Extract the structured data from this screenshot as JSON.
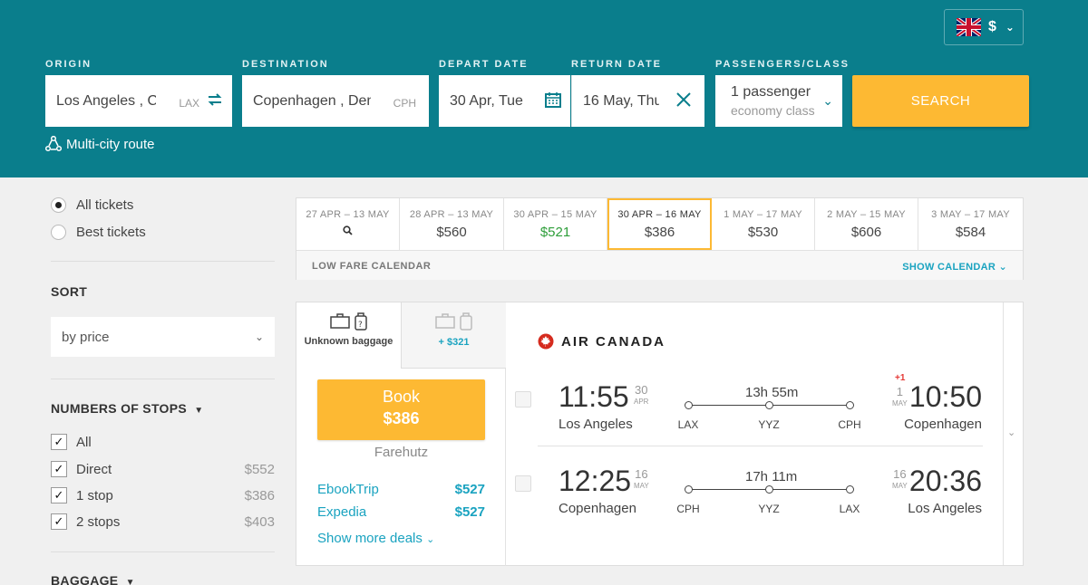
{
  "header": {
    "currency_symbol": "$",
    "labels": {
      "origin": "ORIGIN",
      "destination": "DESTINATION",
      "depart_date": "DEPART DATE",
      "return_date": "RETURN DATE",
      "passengers_class": "PASSENGERS/CLASS"
    },
    "origin_value": "Los Angeles , CA",
    "origin_code": "LAX",
    "destination_value": "Copenhagen , Denmark",
    "destination_code": "CPH",
    "depart_value": "30 Apr, Tue",
    "return_value": "16 May, Thu",
    "passengers": "1 passenger",
    "class": "economy class",
    "search_label": "SEARCH",
    "multicity_label": "Multi-city route"
  },
  "sidebar": {
    "ticket_options": [
      "All tickets",
      "Best tickets"
    ],
    "sort_heading": "SORT",
    "sort_value": "by price",
    "stops_heading": "NUMBERS OF STOPS",
    "stops": [
      {
        "label": "All",
        "price": ""
      },
      {
        "label": "Direct",
        "price": "$552"
      },
      {
        "label": "1 stop",
        "price": "$386"
      },
      {
        "label": "2 stops",
        "price": "$403"
      }
    ],
    "baggage_heading": "BAGGAGE"
  },
  "calendar": {
    "cells": [
      {
        "dates": "27 APR – 13 MAY",
        "price": ""
      },
      {
        "dates": "28 APR – 13 MAY",
        "price": "$560"
      },
      {
        "dates": "30 APR – 15 MAY",
        "price": "$521"
      },
      {
        "dates": "30 APR – 16 MAY",
        "price": "$386"
      },
      {
        "dates": "1 MAY – 17 MAY",
        "price": "$530"
      },
      {
        "dates": "2 MAY – 15 MAY",
        "price": "$606"
      },
      {
        "dates": "3 MAY – 17 MAY",
        "price": "$584"
      }
    ],
    "low_fare_label": "LOW FARE CALENDAR",
    "show_calendar_label": "SHOW CALENDAR",
    "colors": {
      "cheap": "#2e9e3a",
      "active_border": "#fdb933"
    }
  },
  "result": {
    "baggage_tab_label": "Unknown baggage",
    "baggage_extra": "+ $321",
    "book_label": "Book",
    "book_price": "$386",
    "agent": "Farehutz",
    "deals": [
      {
        "name": "EbookTrip",
        "price": "$527"
      },
      {
        "name": "Expedia",
        "price": "$527"
      }
    ],
    "more_deals": "Show more deals",
    "airline": "AIR CANADA",
    "outbound": {
      "dep_time": "11:55",
      "dep_day": "30",
      "dep_month": "APR",
      "dep_city": "Los Angeles",
      "duration": "13h 55m",
      "airports": [
        "LAX",
        "YYZ",
        "CPH"
      ],
      "arr_plus": "+1",
      "arr_day": "1",
      "arr_month": "MAY",
      "arr_time": "10:50",
      "arr_city": "Copenhagen"
    },
    "inbound": {
      "dep_time": "12:25",
      "dep_day": "16",
      "dep_month": "MAY",
      "dep_city": "Copenhagen",
      "duration": "17h 11m",
      "airports": [
        "CPH",
        "YYZ",
        "LAX"
      ],
      "arr_day": "16",
      "arr_month": "MAY",
      "arr_time": "20:36",
      "arr_city": "Los Angeles"
    }
  },
  "colors": {
    "brand": "#0a7e8c",
    "accent": "#fdb933",
    "link": "#1aa3c0"
  }
}
